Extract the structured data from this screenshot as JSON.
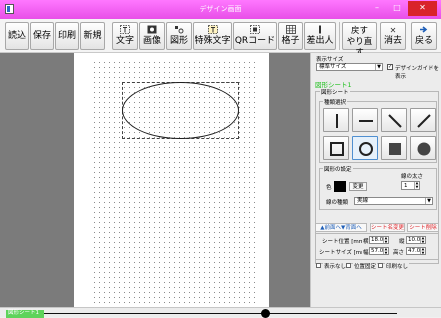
{
  "window": {
    "title": "デザイン画面",
    "min_glyph": "–",
    "max_glyph": "□",
    "close_glyph": "✕"
  },
  "toolbar": {
    "load": "読込",
    "save": "保存",
    "print": "印刷",
    "new": "新規",
    "text": "文字",
    "image": "画像",
    "shape": "図形",
    "special_text": "特殊文字",
    "qr": "QRコード",
    "grid": "格子",
    "sender": "差出人",
    "undo_top": "戻す",
    "redo_bottom": "やり直す",
    "erase": "消去",
    "back": "戻る"
  },
  "toolbar_icons": {
    "text": "text-icon",
    "image": "image-icon",
    "shape": "shape-icon",
    "special_text": "special-text-icon",
    "qr": "qr-icon",
    "grid": "grid-icon",
    "sender": "sender-icon",
    "erase": "erase-icon",
    "back": "back-arrow-icon"
  },
  "panel": {
    "size_label": "表示サイズ",
    "size_value": "標準サイズ",
    "guide_label": "デザインガイドを表示",
    "guide_checked": true,
    "sheet_title": "図形シート1",
    "shape_group": "図形シート",
    "kind_group": "種類選択",
    "settings_group": "図形の設定",
    "color_label": "色",
    "color_value": "#000000",
    "color_button": "変更",
    "width_label": "線の太さ",
    "width_value": "1",
    "linetype_label": "線の種類",
    "linetype_value": "実線",
    "front_back": "▲前面へ▼背面へ",
    "rename": "シート名変更",
    "delete": "シート削除",
    "pos_label": "シート位置 [mm]",
    "pos_x_label": "横",
    "pos_x": "18.0",
    "pos_y_label": "縦",
    "pos_y": "10.0",
    "size_label2": "シートサイズ [mm]",
    "size_w_label": "幅",
    "size_w": "57.0",
    "size_h_label": "高さ",
    "size_h": "47.0",
    "hide_label": "表示なし",
    "fix_label": "位置固定",
    "noprint_label": "印刷なし"
  },
  "status": {
    "sheet_tab": "図形シート1"
  },
  "colors": {
    "titlebar": "#e84fe8",
    "sheet_green": "#21c11f",
    "tab_green": "#5fd35b",
    "close_red": "#d9232b",
    "action_red": "#e0262b",
    "action_blue": "#2a6cc9"
  }
}
